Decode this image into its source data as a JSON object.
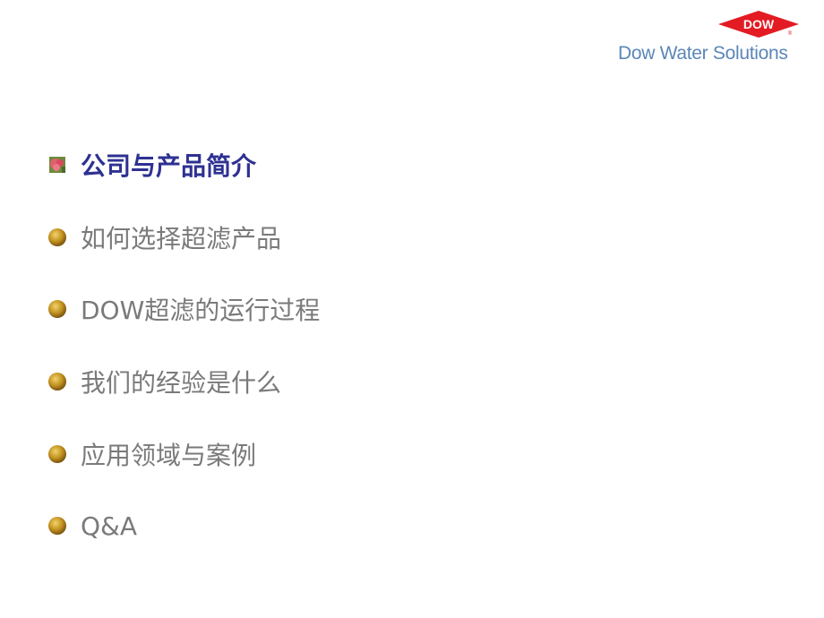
{
  "logo": {
    "brand": "DOW",
    "registered": "®",
    "tagline": "Dow Water Solutions",
    "brand_color": "#e31b23",
    "tagline_color": "#5b86b8"
  },
  "agenda": {
    "items": [
      {
        "label": "公司与产品简介",
        "active": true,
        "bullet_icon": "flower-square-bullet"
      },
      {
        "label": "如何选择超滤产品",
        "active": false,
        "bullet_icon": "gold-coin-bullet"
      },
      {
        "label": "DOW超滤的运行过程",
        "active": false,
        "bullet_icon": "gold-coin-bullet"
      },
      {
        "label": "我们的经验是什么",
        "active": false,
        "bullet_icon": "gold-coin-bullet"
      },
      {
        "label": "应用领域与案例",
        "active": false,
        "bullet_icon": "gold-coin-bullet"
      },
      {
        "label": "Q&A",
        "active": false,
        "bullet_icon": "gold-coin-bullet"
      }
    ],
    "active_color": "#2e3192",
    "inactive_color": "#7a7a7a"
  }
}
